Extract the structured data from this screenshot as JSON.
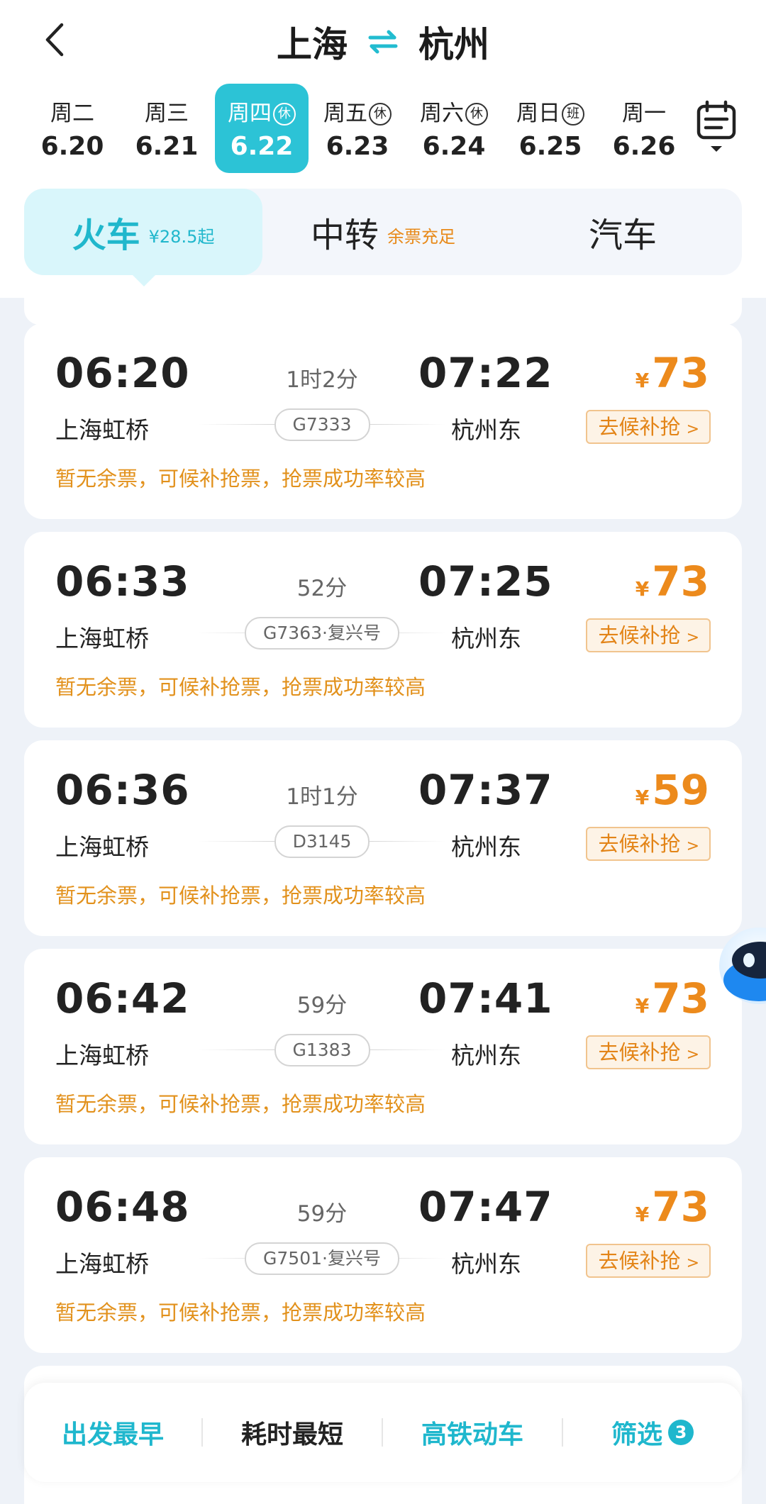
{
  "header": {
    "from": "上海",
    "to": "杭州"
  },
  "dates": [
    {
      "dow": "周二",
      "tag": "",
      "day": "6.20",
      "active": false
    },
    {
      "dow": "周三",
      "tag": "",
      "day": "6.21",
      "active": false
    },
    {
      "dow": "周四",
      "tag": "休",
      "day": "6.22",
      "active": true
    },
    {
      "dow": "周五",
      "tag": "休",
      "day": "6.23",
      "active": false
    },
    {
      "dow": "周六",
      "tag": "休",
      "day": "6.24",
      "active": false
    },
    {
      "dow": "周日",
      "tag": "班",
      "day": "6.25",
      "active": false
    },
    {
      "dow": "周一",
      "tag": "",
      "day": "6.26",
      "active": false
    }
  ],
  "modes": [
    {
      "label": "火车",
      "sub": "¥28.5起"
    },
    {
      "label": "中转",
      "sub": "余票充足"
    },
    {
      "label": "汽车",
      "sub": ""
    }
  ],
  "trains": [
    {
      "dep_time": "06:20",
      "duration": "1时2分",
      "arr_time": "07:22",
      "dep_station": "上海虹桥",
      "train_no": "G7333",
      "arr_station": "杭州东",
      "currency": "¥",
      "price": "73",
      "action": "去候补抢",
      "status": "暂无余票，可候补抢票，抢票成功率较高"
    },
    {
      "dep_time": "06:33",
      "duration": "52分",
      "arr_time": "07:25",
      "dep_station": "上海虹桥",
      "train_no": "G7363·复兴号",
      "arr_station": "杭州东",
      "currency": "¥",
      "price": "73",
      "action": "去候补抢",
      "status": "暂无余票，可候补抢票，抢票成功率较高"
    },
    {
      "dep_time": "06:36",
      "duration": "1时1分",
      "arr_time": "07:37",
      "dep_station": "上海虹桥",
      "train_no": "D3145",
      "arr_station": "杭州东",
      "currency": "¥",
      "price": "59",
      "action": "去候补抢",
      "status": "暂无余票，可候补抢票，抢票成功率较高"
    },
    {
      "dep_time": "06:42",
      "duration": "59分",
      "arr_time": "07:41",
      "dep_station": "上海虹桥",
      "train_no": "G1383",
      "arr_station": "杭州东",
      "currency": "¥",
      "price": "73",
      "action": "去候补抢",
      "status": "暂无余票，可候补抢票，抢票成功率较高"
    },
    {
      "dep_time": "06:48",
      "duration": "59分",
      "arr_time": "07:47",
      "dep_station": "上海虹桥",
      "train_no": "G7501·复兴号",
      "arr_station": "杭州东",
      "currency": "¥",
      "price": "73",
      "action": "去候补抢",
      "status": "暂无余票，可候补抢票，抢票成功率较高"
    }
  ],
  "bottom": {
    "earliest": "出发最早",
    "shortest": "耗时最短",
    "highspeed": "高铁动车",
    "filter": "筛选",
    "filter_count": "3"
  },
  "colors": {
    "accent": "#20b7cc",
    "price": "#ec8a1c",
    "status": "#e2911c"
  }
}
